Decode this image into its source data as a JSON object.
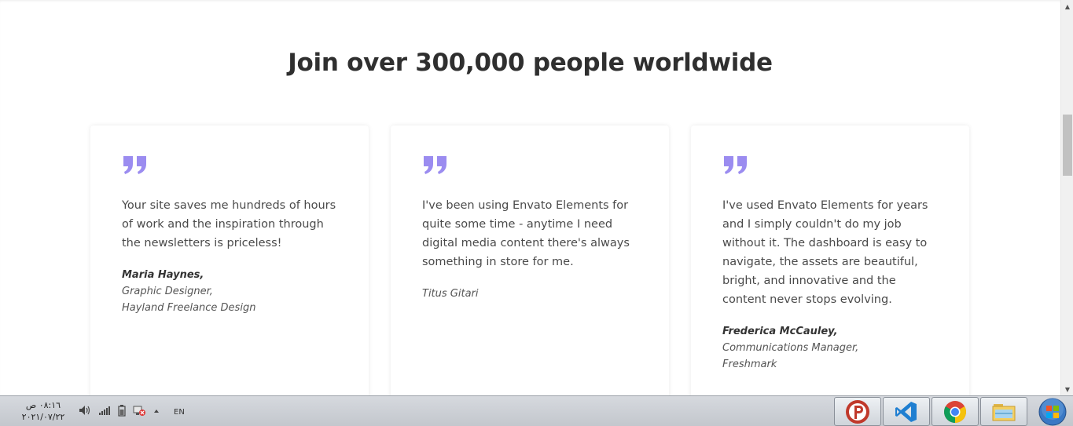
{
  "section": {
    "headline": "Join over 300,000 people worldwide"
  },
  "colors": {
    "quote_accent": "#9b8cf0",
    "heading": "#2f2f2f"
  },
  "testimonials": [
    {
      "quote": "Your site saves me hundreds of hours of work and the inspiration through the newsletters is priceless!",
      "name": "Maria Haynes,",
      "role": "Graphic Designer,",
      "company": "Hayland Freelance Design"
    },
    {
      "quote": "I've been using Envato Elements for quite some time - anytime I need digital media content there's always something in store for me.",
      "name": "",
      "role": "Titus Gitari",
      "company": ""
    },
    {
      "quote": "I've used Envato Elements for years and I simply couldn't do my job without it. The dashboard is easy to navigate, the assets are beautiful, bright, and innovative and the content never stops evolving.",
      "name": "Frederica McCauley,",
      "role": "Communications Manager,",
      "company": "Freshmark"
    }
  ],
  "taskbar": {
    "time": "٠٨:١٦ ص",
    "date": "٢٠٢١/٠٧/٢٢",
    "language": "EN",
    "tray_icons": [
      "speaker-icon",
      "signal-icon",
      "battery-icon",
      "network-icon",
      "show-hidden-icon"
    ],
    "pinned_apps": [
      "psiphon-icon",
      "vscode-icon",
      "chrome-icon",
      "file-explorer-icon"
    ]
  }
}
